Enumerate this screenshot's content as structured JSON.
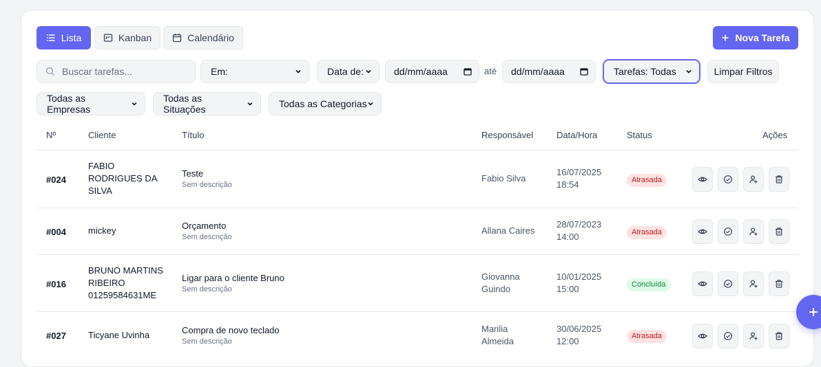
{
  "views": {
    "list": "Lista",
    "kanban": "Kanban",
    "calendar": "Calendário"
  },
  "new_task": "Nova Tarefa",
  "filters": {
    "search_placeholder": "Buscar tarefas...",
    "em": "Em:",
    "date_from_label": "Data de:",
    "date_placeholder_1": "dd/mm/aaaa",
    "ate": "até",
    "date_placeholder_2": "dd/mm/aaaa",
    "tasks": "Tarefas: Todas",
    "clear": "Limpar Filtros",
    "companies": "Todas as Empresas",
    "situations": "Todas as Situações",
    "categories": "Todas as Categorias"
  },
  "columns": {
    "num": "Nº",
    "client": "Cliente",
    "title": "Título",
    "resp": "Responsável",
    "date": "Data/Hora",
    "status": "Status",
    "actions": "Ações"
  },
  "rows": [
    {
      "num": "#024",
      "client_lines": [
        "FABIO",
        "RODRIGUES DA",
        "SILVA"
      ],
      "title": "Teste",
      "desc": "Sem descrição",
      "resp_lines": [
        "Fabio Silva"
      ],
      "date_lines": [
        "16/07/2025",
        "18:54"
      ],
      "status": "Atrasada",
      "status_kind": "late"
    },
    {
      "num": "#004",
      "client_lines": [
        "mickey"
      ],
      "title": "Orçamento",
      "desc": "Sem descrição",
      "resp_lines": [
        "Allana Caires"
      ],
      "date_lines": [
        "28/07/2023",
        "14:00"
      ],
      "status": "Atrasada",
      "status_kind": "late"
    },
    {
      "num": "#016",
      "client_lines": [
        "BRUNO MARTINS",
        "RIBEIRO",
        "01259584631ME"
      ],
      "title": "Ligar para o cliente Bruno",
      "desc": "Sem descrição",
      "resp_lines": [
        "Giovanna",
        "Guindo"
      ],
      "date_lines": [
        "10/01/2025",
        "15:00"
      ],
      "status": "Concluída",
      "status_kind": "done"
    },
    {
      "num": "#027",
      "client_lines": [
        "Ticyane Uvinha"
      ],
      "title": "Compra de novo teclado",
      "desc": "Sem descrição",
      "resp_lines": [
        "Marilia",
        "Almeida"
      ],
      "date_lines": [
        "30/06/2025",
        "12:00"
      ],
      "status": "Atrasada",
      "status_kind": "late"
    }
  ],
  "colors": {
    "accent": "#6366f1",
    "late_bg": "#fee2e2",
    "late_fg": "#b91c1c",
    "done_bg": "#dcfce7",
    "done_fg": "#15803d"
  }
}
